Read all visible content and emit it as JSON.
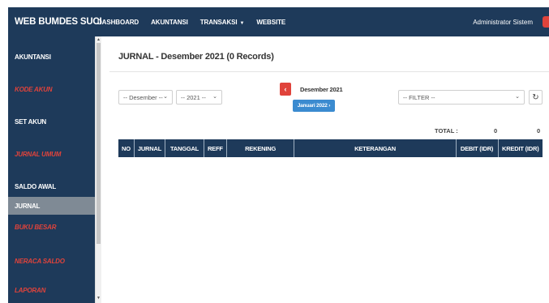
{
  "navbar": {
    "brand": "WEB BUMDES SUCI",
    "items": [
      "DASHBOARD",
      "AKUNTANSI",
      "TRANSAKSI",
      "WEBSITE"
    ],
    "user": "Administrator Sistem"
  },
  "sidebar": {
    "items": [
      {
        "label": "AKUNTANSI",
        "style": "white"
      },
      {
        "label": "KODE AKUN",
        "style": "red"
      },
      {
        "label": "SET AKUN",
        "style": "white"
      },
      {
        "label": "JURNAL UMUM",
        "style": "red"
      },
      {
        "label": "SALDO AWAL",
        "style": "white"
      },
      {
        "label": "JURNAL",
        "style": "active"
      },
      {
        "label": "BUKU BESAR",
        "style": "red"
      },
      {
        "label": "NERACA SALDO",
        "style": "red"
      },
      {
        "label": "LAPORAN",
        "style": "red"
      }
    ]
  },
  "page": {
    "title": "JURNAL - Desember 2021 (0 Records)"
  },
  "filters": {
    "month_select": "-- Desember --",
    "year_select": "-- 2021 --",
    "current_month": "Desember 2021",
    "next_month_button": "Januari 2022",
    "filter_select": "-- FILTER --"
  },
  "totals": {
    "label": "TOTAL :",
    "debit": "0",
    "kredit": "0"
  },
  "table": {
    "columns": [
      "NO",
      "JURNAL",
      "TANGGAL",
      "REFF",
      "REKENING",
      "KETERANGAN",
      "DEBIT (IDR)",
      "KREDIT (IDR)"
    ]
  },
  "colors": {
    "navy": "#1e3a5a",
    "red": "#e0433b",
    "blue": "#3b8bd0",
    "active_gray": "#7f8a95"
  },
  "icons": {
    "prev": "chevron-left-icon",
    "next": "chevron-right-icon",
    "refresh": "refresh-icon"
  }
}
